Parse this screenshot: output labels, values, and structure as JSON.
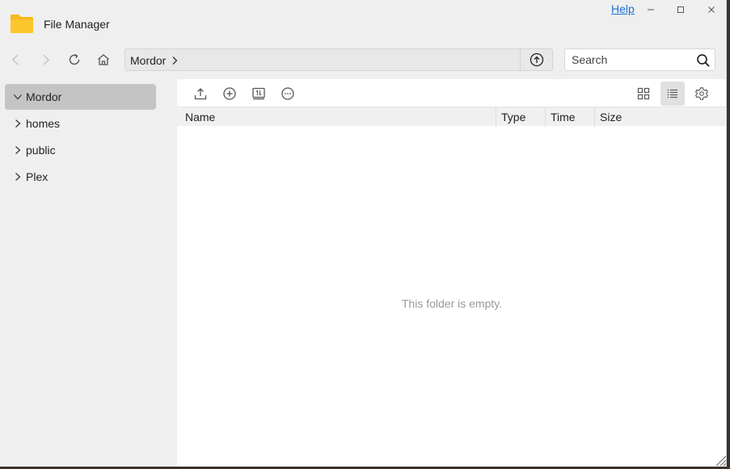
{
  "app": {
    "title": "File Manager",
    "help_label": "Help"
  },
  "window_controls": {
    "minimize": "minimize-icon",
    "maximize": "maximize-icon",
    "close": "close-icon"
  },
  "nav": {
    "back_icon": "chevron-left-icon",
    "forward_icon": "chevron-right-icon",
    "refresh_icon": "refresh-icon",
    "home_icon": "home-icon",
    "path": "Mordor",
    "up_icon": "arrow-up-circle-icon"
  },
  "search": {
    "placeholder": "Search",
    "value": ""
  },
  "sidebar": {
    "items": [
      {
        "label": "Mordor",
        "expanded": true,
        "selected": true
      },
      {
        "label": "homes",
        "expanded": false,
        "selected": false
      },
      {
        "label": "public",
        "expanded": false,
        "selected": false
      },
      {
        "label": "Plex",
        "expanded": false,
        "selected": false
      }
    ]
  },
  "toolbar": {
    "upload_icon": "upload-icon",
    "new_icon": "plus-circle-icon",
    "transfer_icon": "transfer-icon",
    "more_icon": "more-icon",
    "grid_view_icon": "grid-view-icon",
    "list_view_icon": "list-view-icon",
    "settings_icon": "gear-icon",
    "active_view": "list"
  },
  "table": {
    "columns": [
      "Name",
      "Type",
      "Time",
      "Size"
    ],
    "rows": []
  },
  "empty_message": "This folder is empty.",
  "colors": {
    "folder_icon": "#f9b91b",
    "link": "#1a73d9",
    "selected_bg": "#c4c4c4",
    "empty_text": "#999999"
  }
}
